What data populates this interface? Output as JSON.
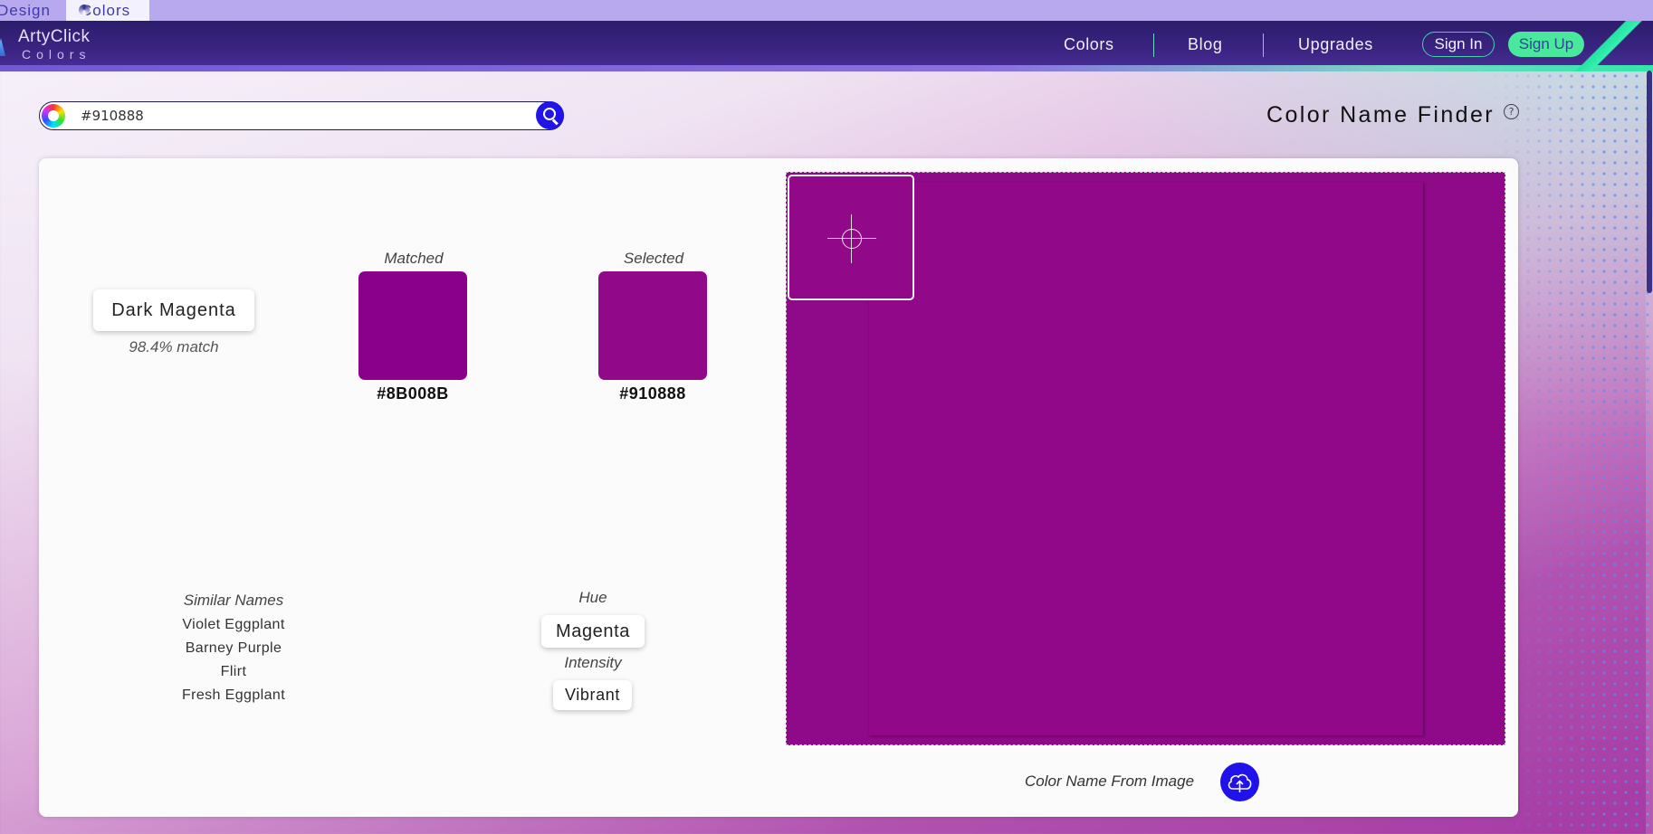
{
  "tabs": {
    "design": "Design",
    "colors": "Colors"
  },
  "logo": {
    "top": "ArtyClick",
    "bottom": "Colors"
  },
  "nav": {
    "colors": "Colors",
    "blog": "Blog",
    "upgrades": "Upgrades",
    "sign_in": "Sign In",
    "sign_up": "Sign Up"
  },
  "search": {
    "value": "#910888"
  },
  "page": {
    "title": "Color Name Finder",
    "help": "?"
  },
  "result": {
    "name": "Dark Magenta",
    "match": "98.4% match",
    "matched_label": "Matched",
    "matched_hex": "#8B008B",
    "matched_color": "#8B008B",
    "selected_label": "Selected",
    "selected_hex": "#910888",
    "selected_color": "#910888"
  },
  "similar": {
    "label": "Similar Names",
    "items": [
      "Violet Eggplant",
      "Barney Purple",
      "Flirt",
      "Fresh Eggplant"
    ]
  },
  "attributes": {
    "hue_label": "Hue",
    "hue": "Magenta",
    "intensity_label": "Intensity",
    "intensity": "Vibrant"
  },
  "image_picker": {
    "from_image_label": "Color Name From Image"
  },
  "colors": {
    "header_bg": "#2c1d6c",
    "accent_green": "#4ae89d",
    "button_blue": "#2014e8"
  }
}
